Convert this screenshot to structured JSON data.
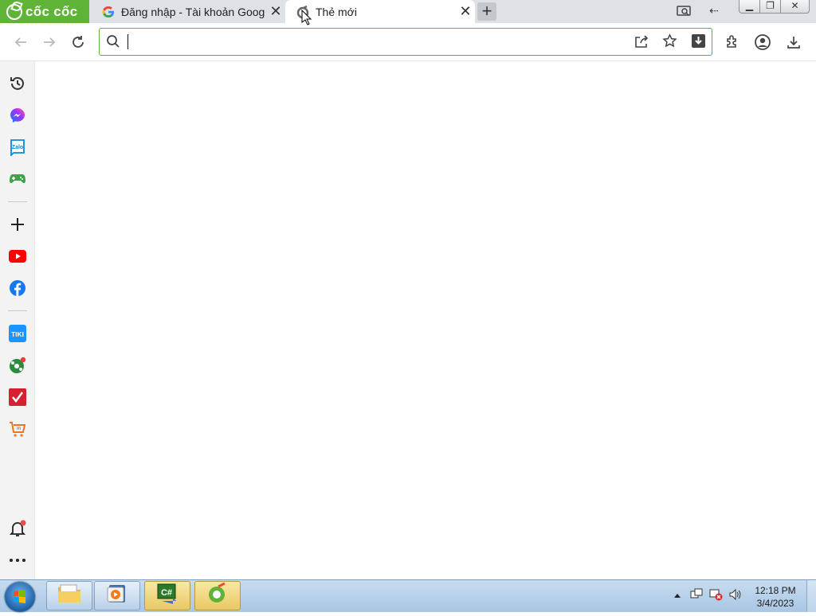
{
  "browser": {
    "brand": "cốc cốc",
    "tabs": [
      {
        "title": "Đăng nhập - Tài khoản Goog",
        "favicon": "google-icon",
        "active": false
      },
      {
        "title": "Thẻ mới",
        "favicon": "coccoc-icon",
        "active": true
      }
    ],
    "new_tab_label": "+",
    "accent_color": "#5fb336"
  },
  "toolbar": {
    "address_value": "",
    "address_placeholder": ""
  },
  "sidebar": {
    "items": [
      {
        "name": "history-icon"
      },
      {
        "name": "messenger-icon"
      },
      {
        "name": "zalo-icon",
        "label": "Zalo"
      },
      {
        "name": "game-icon"
      },
      {
        "name": "add-icon"
      },
      {
        "name": "youtube-icon"
      },
      {
        "name": "facebook-icon"
      },
      {
        "name": "tiki-icon",
        "label": "TIKI"
      },
      {
        "name": "football-icon"
      },
      {
        "name": "checklist-icon"
      },
      {
        "name": "shopping-cart-icon"
      },
      {
        "name": "notification-bell-icon"
      },
      {
        "name": "more-icon"
      }
    ]
  },
  "taskbar": {
    "pinned": [
      "file-explorer-icon",
      "media-player-icon",
      "csharp-app-icon",
      "coccoc-browser-icon"
    ],
    "clock_time": "12:18 PM",
    "clock_date": "3/4/2023"
  }
}
